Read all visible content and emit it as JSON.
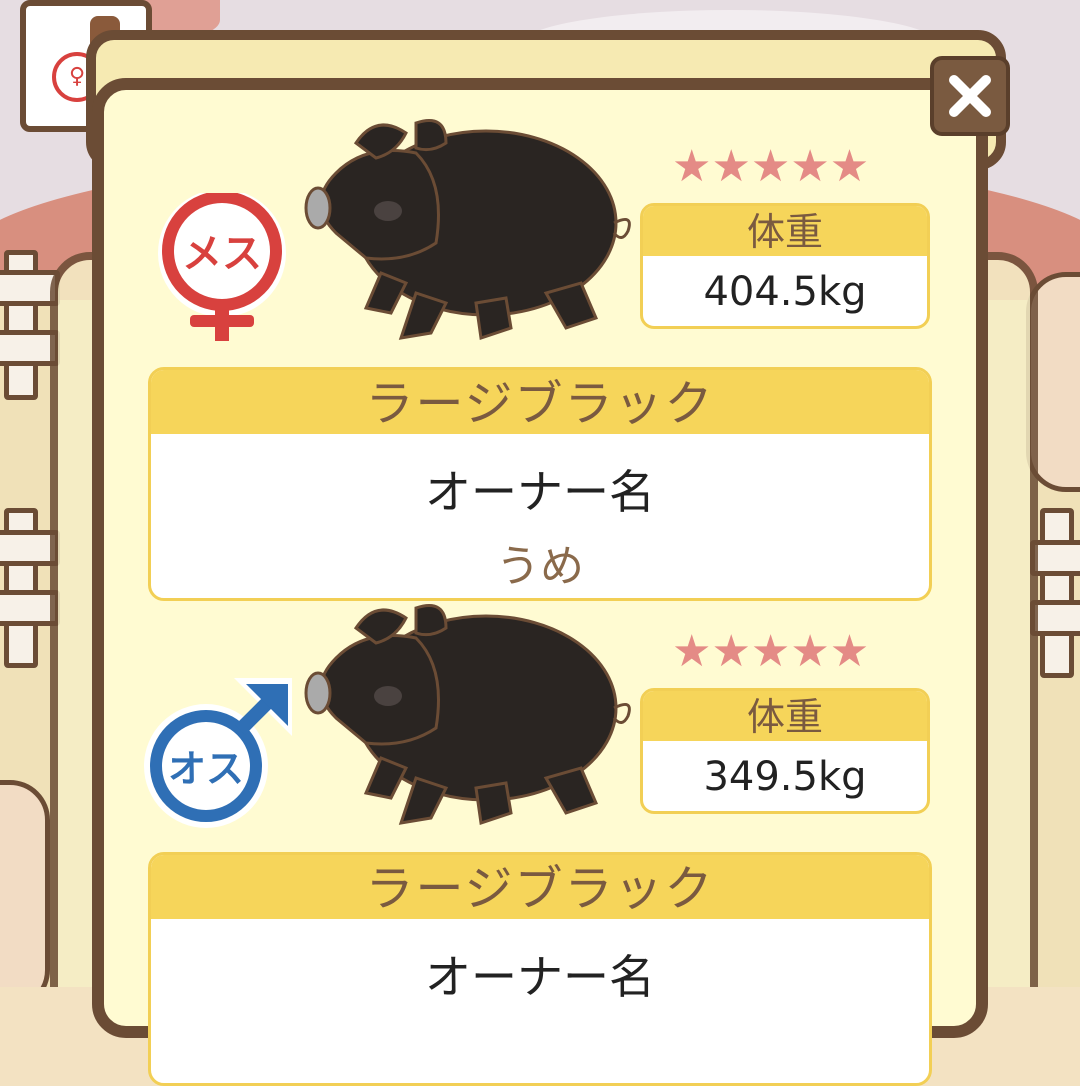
{
  "pigs": [
    {
      "gender_label": "メス",
      "stars": "★★★★★",
      "weight_label": "体重",
      "weight": "404.5kg",
      "breed": "ラージブラック",
      "owner_label": "オーナー名",
      "owner_name": "うめ"
    },
    {
      "gender_label": "オス",
      "stars": "★★★★★",
      "weight_label": "体重",
      "weight": "349.5kg",
      "breed": "ラージブラック",
      "owner_label": "オーナー名",
      "owner_name": ""
    }
  ],
  "close_icon": "close-icon",
  "colors": {
    "panel": "#fffbd2",
    "border": "#6b4c35",
    "header_yellow": "#f6d55a",
    "star_pink": "#e48b86",
    "female_red": "#d8413e",
    "male_blue": "#2f6fb5"
  }
}
